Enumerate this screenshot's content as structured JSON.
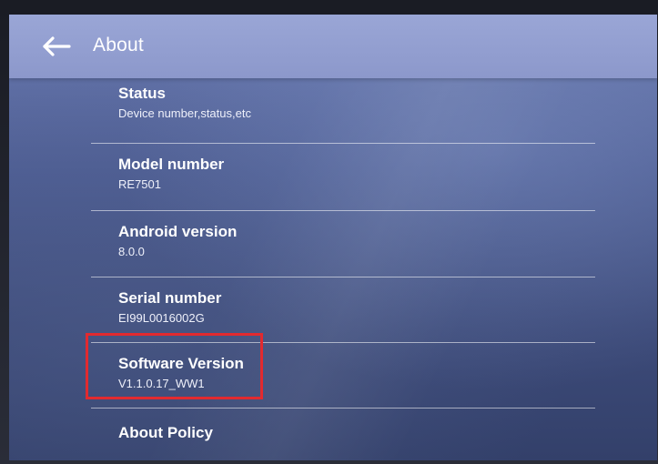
{
  "app_bar": {
    "title": "About",
    "back_icon": "arrow-back-icon",
    "background": "#8c98cb"
  },
  "settings": {
    "items": [
      {
        "label": "Status",
        "summary": "Device number,status,etc"
      },
      {
        "label": "Model number",
        "summary": "RE7501"
      },
      {
        "label": "Android version",
        "summary": "8.0.0"
      },
      {
        "label": "Serial number",
        "summary": "EI99L0016002G"
      },
      {
        "label": "Software Version",
        "summary": "V1.1.0.17_WW1"
      },
      {
        "label": "About Policy",
        "summary": ""
      }
    ]
  },
  "annotation": {
    "highlight_color": "#e22a2f",
    "highlighted_item": "Software Version"
  }
}
